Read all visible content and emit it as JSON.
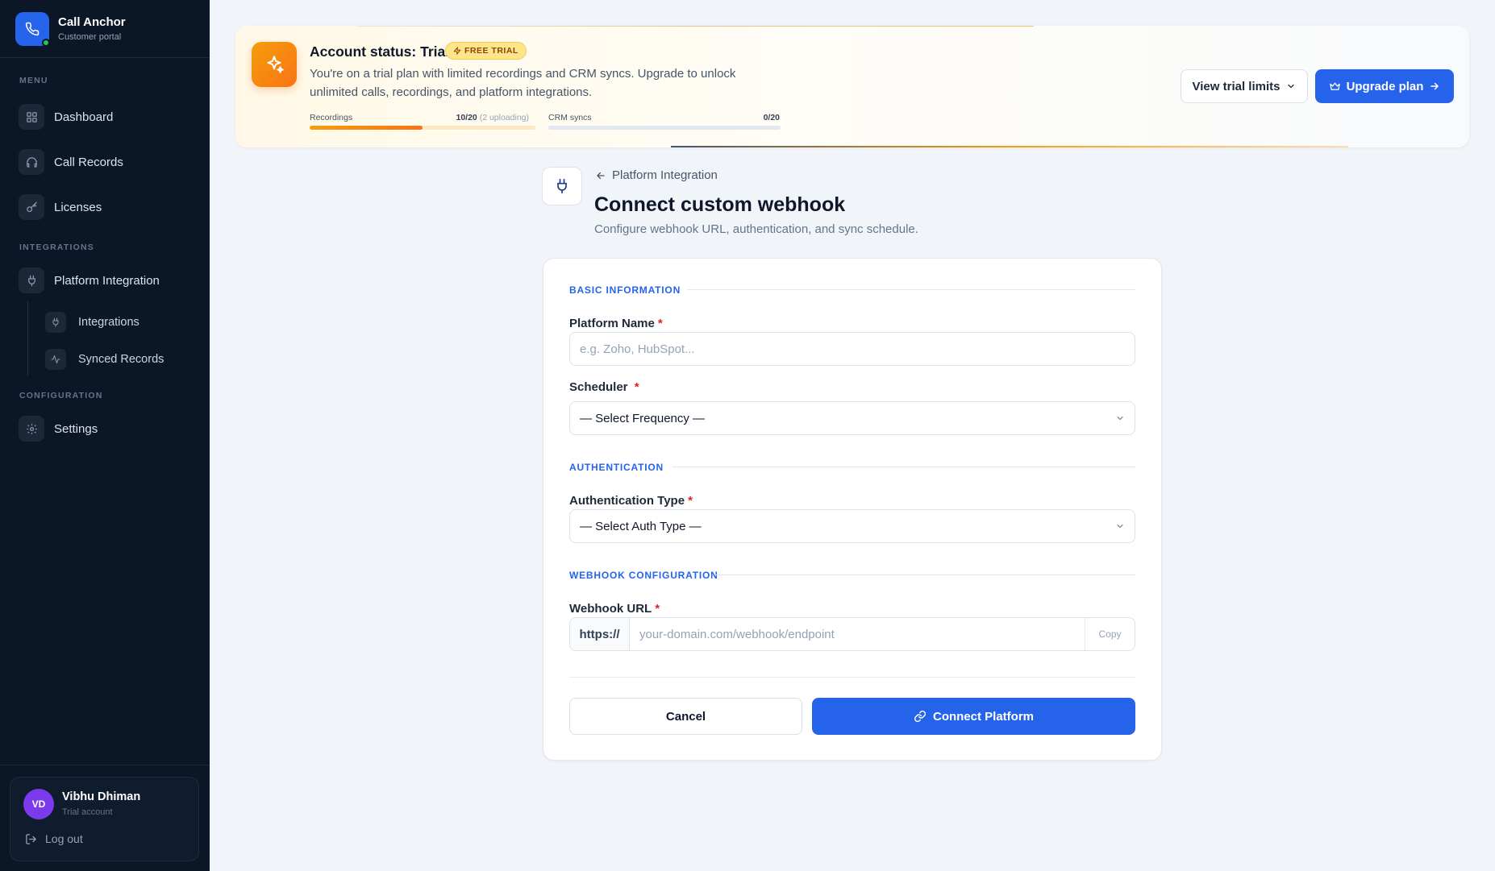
{
  "brand": {
    "title": "Call Anchor",
    "subtitle": "Customer portal"
  },
  "sidebar": {
    "menu_label": "MENU",
    "menu_items": [
      {
        "label": "Dashboard",
        "icon": "grid-icon"
      },
      {
        "label": "Call Records",
        "icon": "headphones-icon"
      },
      {
        "label": "Licenses",
        "icon": "key-icon"
      }
    ],
    "integrations_label": "INTEGRATIONS",
    "platform_integration": {
      "label": "Platform Integration",
      "icon": "plug-icon"
    },
    "sub_items": [
      {
        "label": "Integrations",
        "icon": "plug-icon"
      },
      {
        "label": "Synced Records",
        "icon": "activity-icon"
      }
    ],
    "configuration_label": "CONFIGURATION",
    "settings": {
      "label": "Settings",
      "icon": "gear-icon"
    }
  },
  "user": {
    "initials": "VD",
    "name": "Vibhu Dhiman",
    "role": "Trial account",
    "logout_label": "Log out"
  },
  "banner": {
    "title": "Account status: Trial",
    "badge": "FREE TRIAL",
    "description": "You're on a trial plan with limited recordings and CRM syncs. Upgrade to unlock unlimited calls, recordings, and platform integrations.",
    "recordings": {
      "label": "Recordings",
      "value": "10/20",
      "note": "(2 uploading)",
      "progress": 0.5
    },
    "crm": {
      "label": "CRM syncs",
      "value": "0/20",
      "progress": 0
    },
    "view_limits_label": "View trial limits",
    "upgrade_label": "Upgrade plan"
  },
  "header": {
    "breadcrumb": "Platform Integration",
    "title": "Connect custom webhook",
    "subtitle": "Configure webhook URL, authentication, and sync schedule."
  },
  "form": {
    "basic_section": "BASIC INFORMATION",
    "platform_name_label": "Platform Name",
    "required_mark": "*",
    "platform_name_placeholder": "e.g. Zoho, HubSpot...",
    "scheduler_label": "Scheduler",
    "scheduler_value": "— Select Frequency —",
    "auth_section": "AUTHENTICATION",
    "auth_type_label": "Authentication Type",
    "auth_type_value": "— Select Auth Type —",
    "webhook_section": "WEBHOOK CONFIGURATION",
    "webhook_url_label": "Webhook URL",
    "url_prefix": "https://",
    "url_placeholder": "your-domain.com/webhook/endpoint",
    "copy_label": "Copy",
    "cancel_label": "Cancel",
    "connect_label": "Connect Platform"
  },
  "colors": {
    "accent": "#2563eb",
    "sidebar_bg": "#0b1727",
    "trial_orange": "#f97316",
    "required": "#dc2626"
  }
}
